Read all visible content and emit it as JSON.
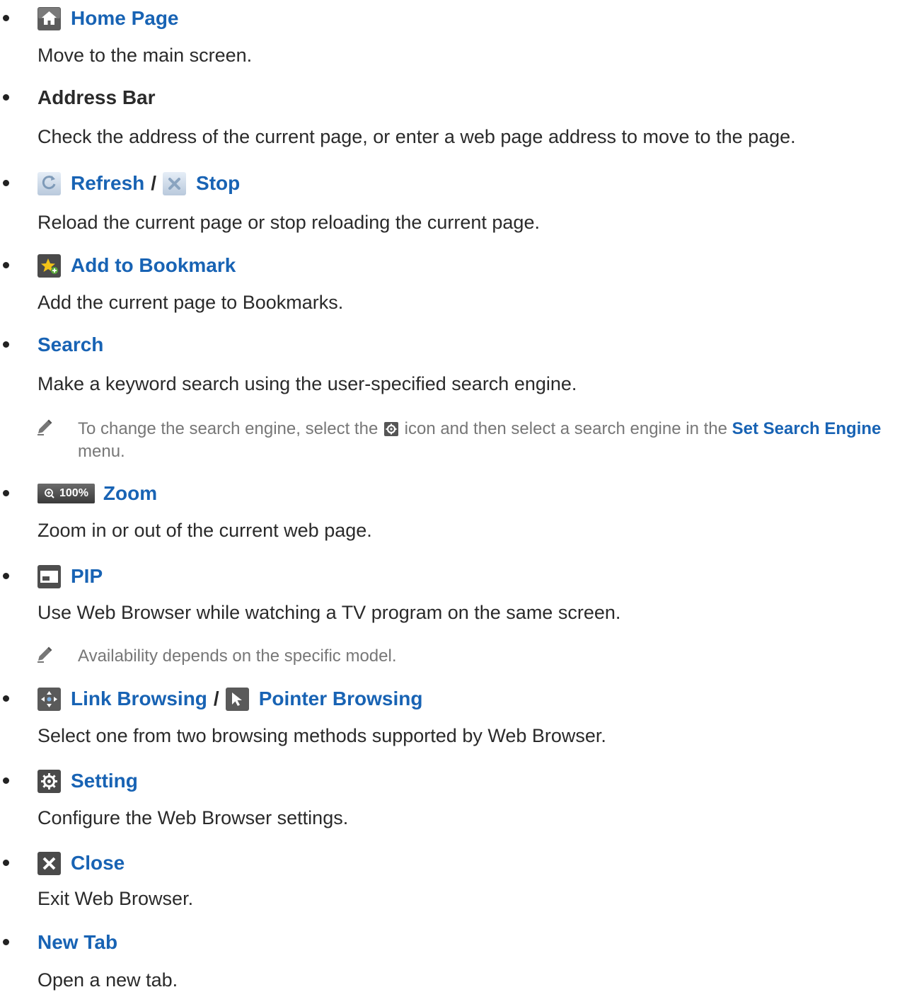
{
  "items": [
    {
      "label": "Home Page",
      "desc": "Move to the main screen."
    },
    {
      "label": "Address Bar",
      "desc": "Check the address of the current page, or enter a web page address to move to the page."
    },
    {
      "label": "Refresh",
      "label2": "Stop",
      "separator": "/",
      "desc": "Reload the current page or stop reloading the current page."
    },
    {
      "label": "Add to Bookmark",
      "desc": "Add the current page to Bookmarks."
    },
    {
      "label": "Search",
      "desc": "Make a keyword search using the user-specified search engine.",
      "note": {
        "before": "To change the search engine, select the",
        "middle": "icon and then select a search engine in the",
        "link": "Set Search Engine",
        "after": "menu."
      }
    },
    {
      "label": "Zoom",
      "badge": "100%",
      "desc": "Zoom in or out of the current web page."
    },
    {
      "label": "PIP",
      "desc": "Use Web Browser while watching a TV program on the same screen.",
      "note": "Availability depends on the specific model."
    },
    {
      "label": "Link Browsing",
      "label2": "Pointer Browsing",
      "separator": "/",
      "desc": "Select one from two browsing methods supported by Web Browser."
    },
    {
      "label": "Setting",
      "desc": "Configure the Web Browser settings."
    },
    {
      "label": "Close",
      "desc": "Exit Web Browser."
    },
    {
      "label": "New Tab",
      "desc": "Open a new tab."
    }
  ],
  "icons": {
    "home": "home-icon",
    "refresh": "refresh-icon",
    "stop": "stop-icon",
    "bookmark": "add-bookmark-icon",
    "gear_small": "gear-icon",
    "zoom": "zoom-icon",
    "pip": "pip-icon",
    "link": "link-browsing-icon",
    "pointer": "pointer-icon",
    "setting": "setting-icon",
    "close": "close-icon",
    "note": "pencil-icon"
  },
  "colors": {
    "link": "#1863b4",
    "text": "#2a2a2a",
    "note": "#777777"
  }
}
